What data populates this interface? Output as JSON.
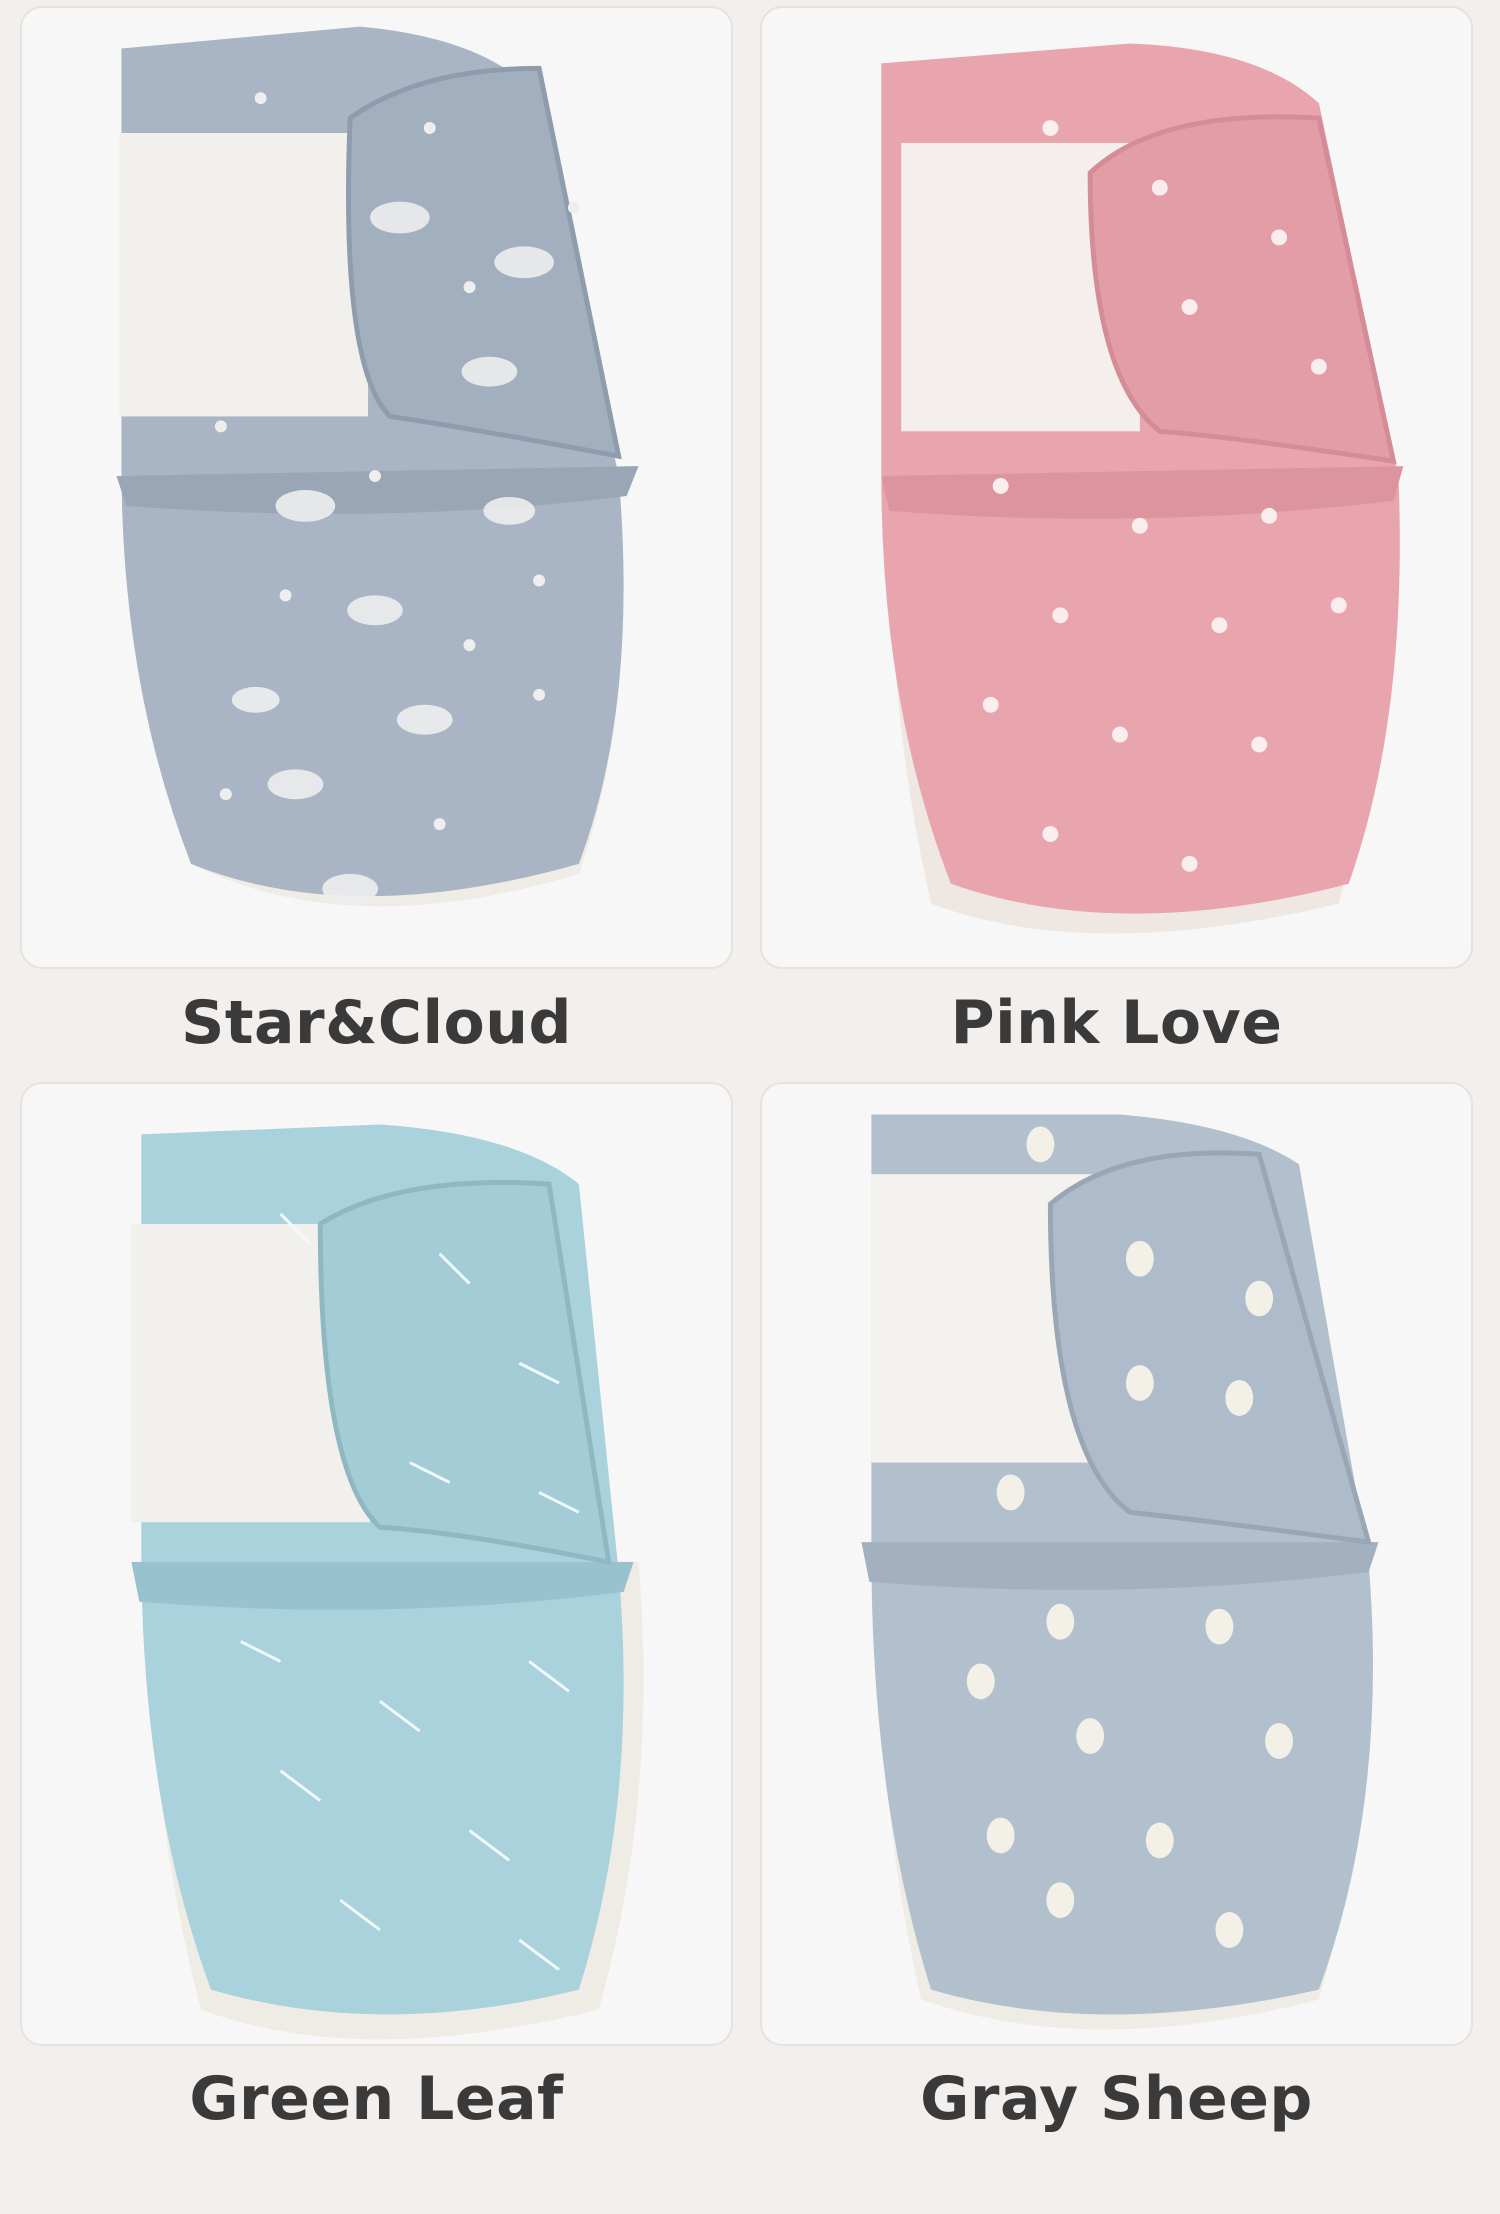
{
  "products": [
    {
      "name": "Star&Cloud",
      "color": "#a9b5c4",
      "pattern": "star-cloud"
    },
    {
      "name": "Pink Love",
      "color": "#e8a5ae",
      "pattern": "heart"
    },
    {
      "name": "Green Leaf",
      "color": "#a9d2dc",
      "pattern": "leaf"
    },
    {
      "name": "Gray Sheep",
      "color": "#b2c0ce",
      "pattern": "sheep"
    }
  ]
}
